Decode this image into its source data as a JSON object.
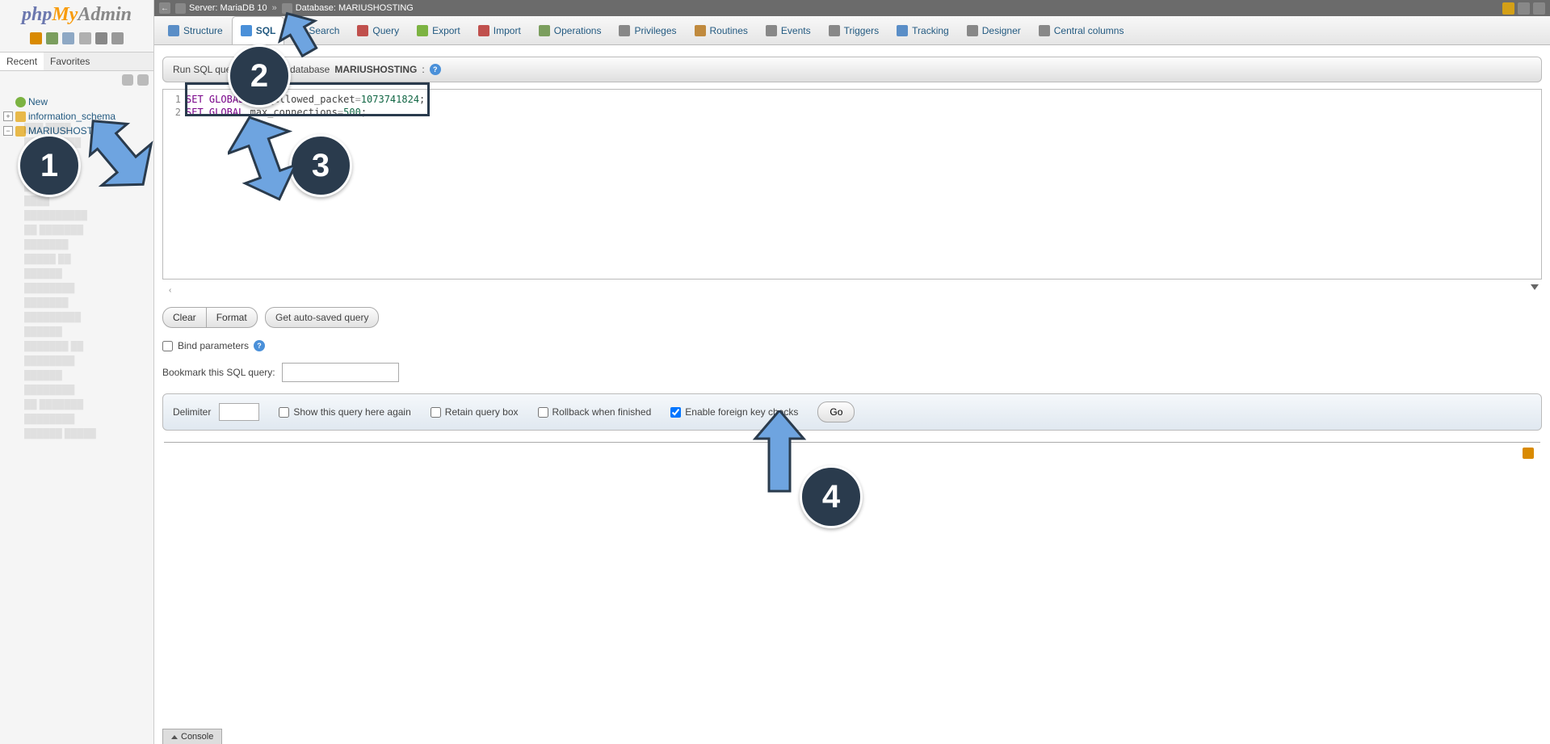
{
  "logo": {
    "part1": "php",
    "part2": "My",
    "part3": "Admin"
  },
  "sidebar": {
    "recent": "Recent",
    "favorites": "Favorites",
    "new": "New",
    "db1": "information_schema",
    "db2": "MARIUSHOSTING"
  },
  "breadcrumb": {
    "server_label": "Server:",
    "server_value": "MariaDB 10",
    "sep": "»",
    "db_label": "Database:",
    "db_value": "MARIUSHOSTING"
  },
  "tabs": {
    "structure": "Structure",
    "sql": "SQL",
    "search": "Search",
    "query": "Query",
    "export": "Export",
    "import": "Import",
    "operations": "Operations",
    "privileges": "Privileges",
    "routines": "Routines",
    "events": "Events",
    "triggers": "Triggers",
    "tracking": "Tracking",
    "designer": "Designer",
    "central_columns": "Central columns"
  },
  "title": {
    "prefix": "Run SQL query/queries on database ",
    "db": "MARIUSHOSTING",
    "suffix": ":"
  },
  "sql": {
    "l1_set": "SET",
    "l1_global": "GLOBAL",
    "l1_var": "max_allowed_packet",
    "l1_num": "1073741824",
    "l2_set": "SET",
    "l2_global": "GLOBAL",
    "l2_var": "max_connections",
    "l2_num": "500"
  },
  "gutter": {
    "n1": "1",
    "n2": "2"
  },
  "buttons": {
    "clear": "Clear",
    "format": "Format",
    "get_auto": "Get auto-saved query"
  },
  "bind_params": "Bind parameters",
  "bookmark_label": "Bookmark this SQL query:",
  "options": {
    "delimiter": "Delimiter",
    "show_again": "Show this query here again",
    "retain": "Retain query box",
    "rollback": "Rollback when finished",
    "fk": "Enable foreign key checks",
    "go": "Go"
  },
  "console": "Console",
  "callouts": {
    "c1": "1",
    "c2": "2",
    "c3": "3",
    "c4": "4"
  },
  "scroll_left": "‹"
}
